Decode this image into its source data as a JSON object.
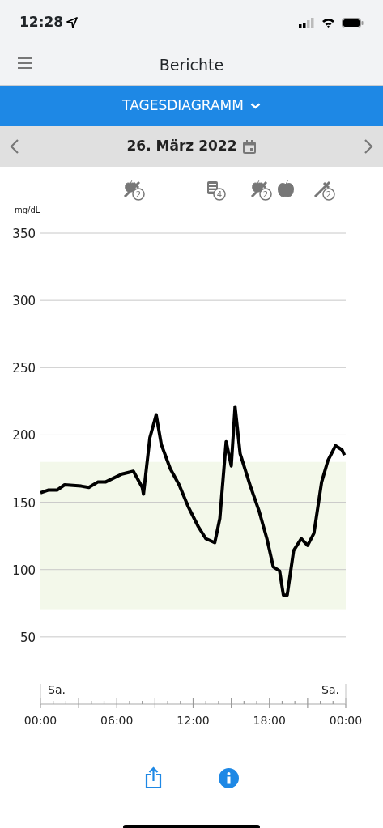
{
  "status_bar": {
    "time": "12:28"
  },
  "header": {
    "title": "Berichte"
  },
  "report_selector": {
    "label": "TAGESDIAGRAMM"
  },
  "date_bar": {
    "date": "26. März 2022"
  },
  "chart": {
    "day_labels": [
      "Sa.",
      "Sa."
    ],
    "chart_data": {
      "type": "line",
      "ylabel": "mg/dL",
      "x": [
        0,
        0.6,
        1.3,
        1.9,
        3.2,
        3.8,
        4.5,
        5.1,
        6.4,
        7.3,
        8.0,
        8.1,
        8.6,
        9.1,
        9.5,
        10.2,
        10.9,
        11.6,
        12.4,
        13.0,
        13.7,
        14.1,
        14.6,
        15.0,
        15.3,
        15.7,
        16.5,
        17.2,
        17.8,
        18.3,
        18.8,
        19.1,
        19.4,
        19.9,
        20.5,
        21.0,
        21.5,
        22.1,
        22.6,
        23.2,
        23.7,
        23.9
      ],
      "series": [
        {
          "color": "#000000",
          "values": [
            157,
            159,
            159,
            163,
            162,
            161,
            165,
            165,
            171,
            173,
            161,
            156,
            198,
            215,
            193,
            175,
            163,
            147,
            132,
            123,
            120,
            138,
            195,
            177,
            221,
            186,
            162,
            143,
            123,
            102,
            99,
            81,
            81,
            114,
            123,
            118,
            127,
            165,
            181,
            192,
            189,
            185
          ]
        }
      ],
      "xlim": [
        0,
        24
      ],
      "ylim": [
        0,
        350
      ],
      "grid": true,
      "xticks": [
        {
          "value": 0,
          "label": "00:00"
        },
        {
          "value": 6,
          "label": "06:00"
        },
        {
          "value": 12,
          "label": "12:00"
        },
        {
          "value": 18,
          "label": "18:00"
        },
        {
          "value": 24,
          "label": "00:00"
        }
      ],
      "yticks": [
        50,
        100,
        150,
        200,
        250,
        300,
        350
      ],
      "bands": [
        {
          "axis": "y",
          "from": 70,
          "to": 180
        }
      ]
    },
    "events": [
      {
        "kind": "insulin-food",
        "count": "2"
      },
      {
        "kind": "note",
        "count": "4"
      },
      {
        "kind": "insulin-food",
        "count": "2"
      },
      {
        "kind": "food"
      },
      {
        "kind": "insulin",
        "count": "2"
      }
    ]
  }
}
